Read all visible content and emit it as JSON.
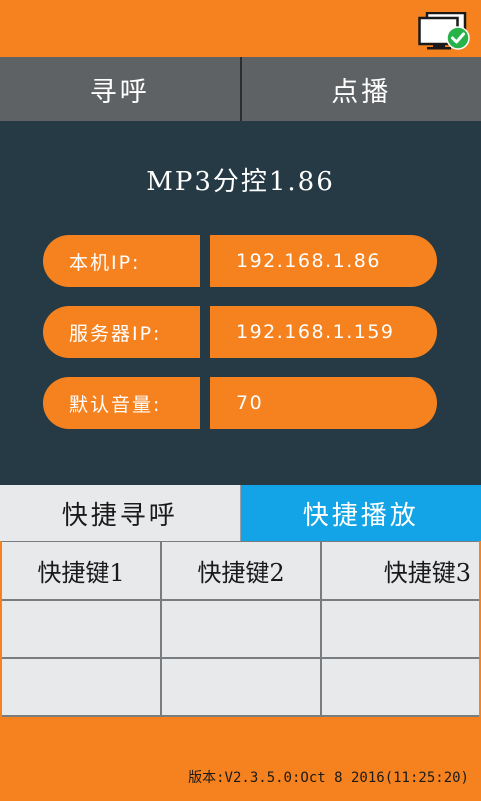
{
  "header": {
    "status_icon": "monitor-connected-icon"
  },
  "main_tabs": [
    {
      "label": "寻呼"
    },
    {
      "label": "点播"
    }
  ],
  "info": {
    "title": "MP3分控1.86",
    "rows": [
      {
        "label": "本机IP:",
        "value": "192.168.1.86"
      },
      {
        "label": "服务器IP:",
        "value": "192.168.1.159"
      },
      {
        "label": "默认音量:",
        "value": "70"
      }
    ]
  },
  "quick_tabs": [
    {
      "label": "快捷寻呼",
      "active": false
    },
    {
      "label": "快捷播放",
      "active": true
    }
  ],
  "hotkeys": {
    "headers": [
      "快捷键1",
      "快捷键2",
      "快捷键3"
    ],
    "rows": [
      [
        "",
        "",
        ""
      ],
      [
        "",
        "",
        ""
      ]
    ]
  },
  "footer": {
    "version": "版本:V2.3.5.0:Oct 8 2016(11:25:20)"
  },
  "colors": {
    "orange": "#f5821f",
    "panel": "#263a45",
    "tab_gray": "#5f6265",
    "active_blue": "#12a4e6",
    "status_green": "#27b24a"
  }
}
